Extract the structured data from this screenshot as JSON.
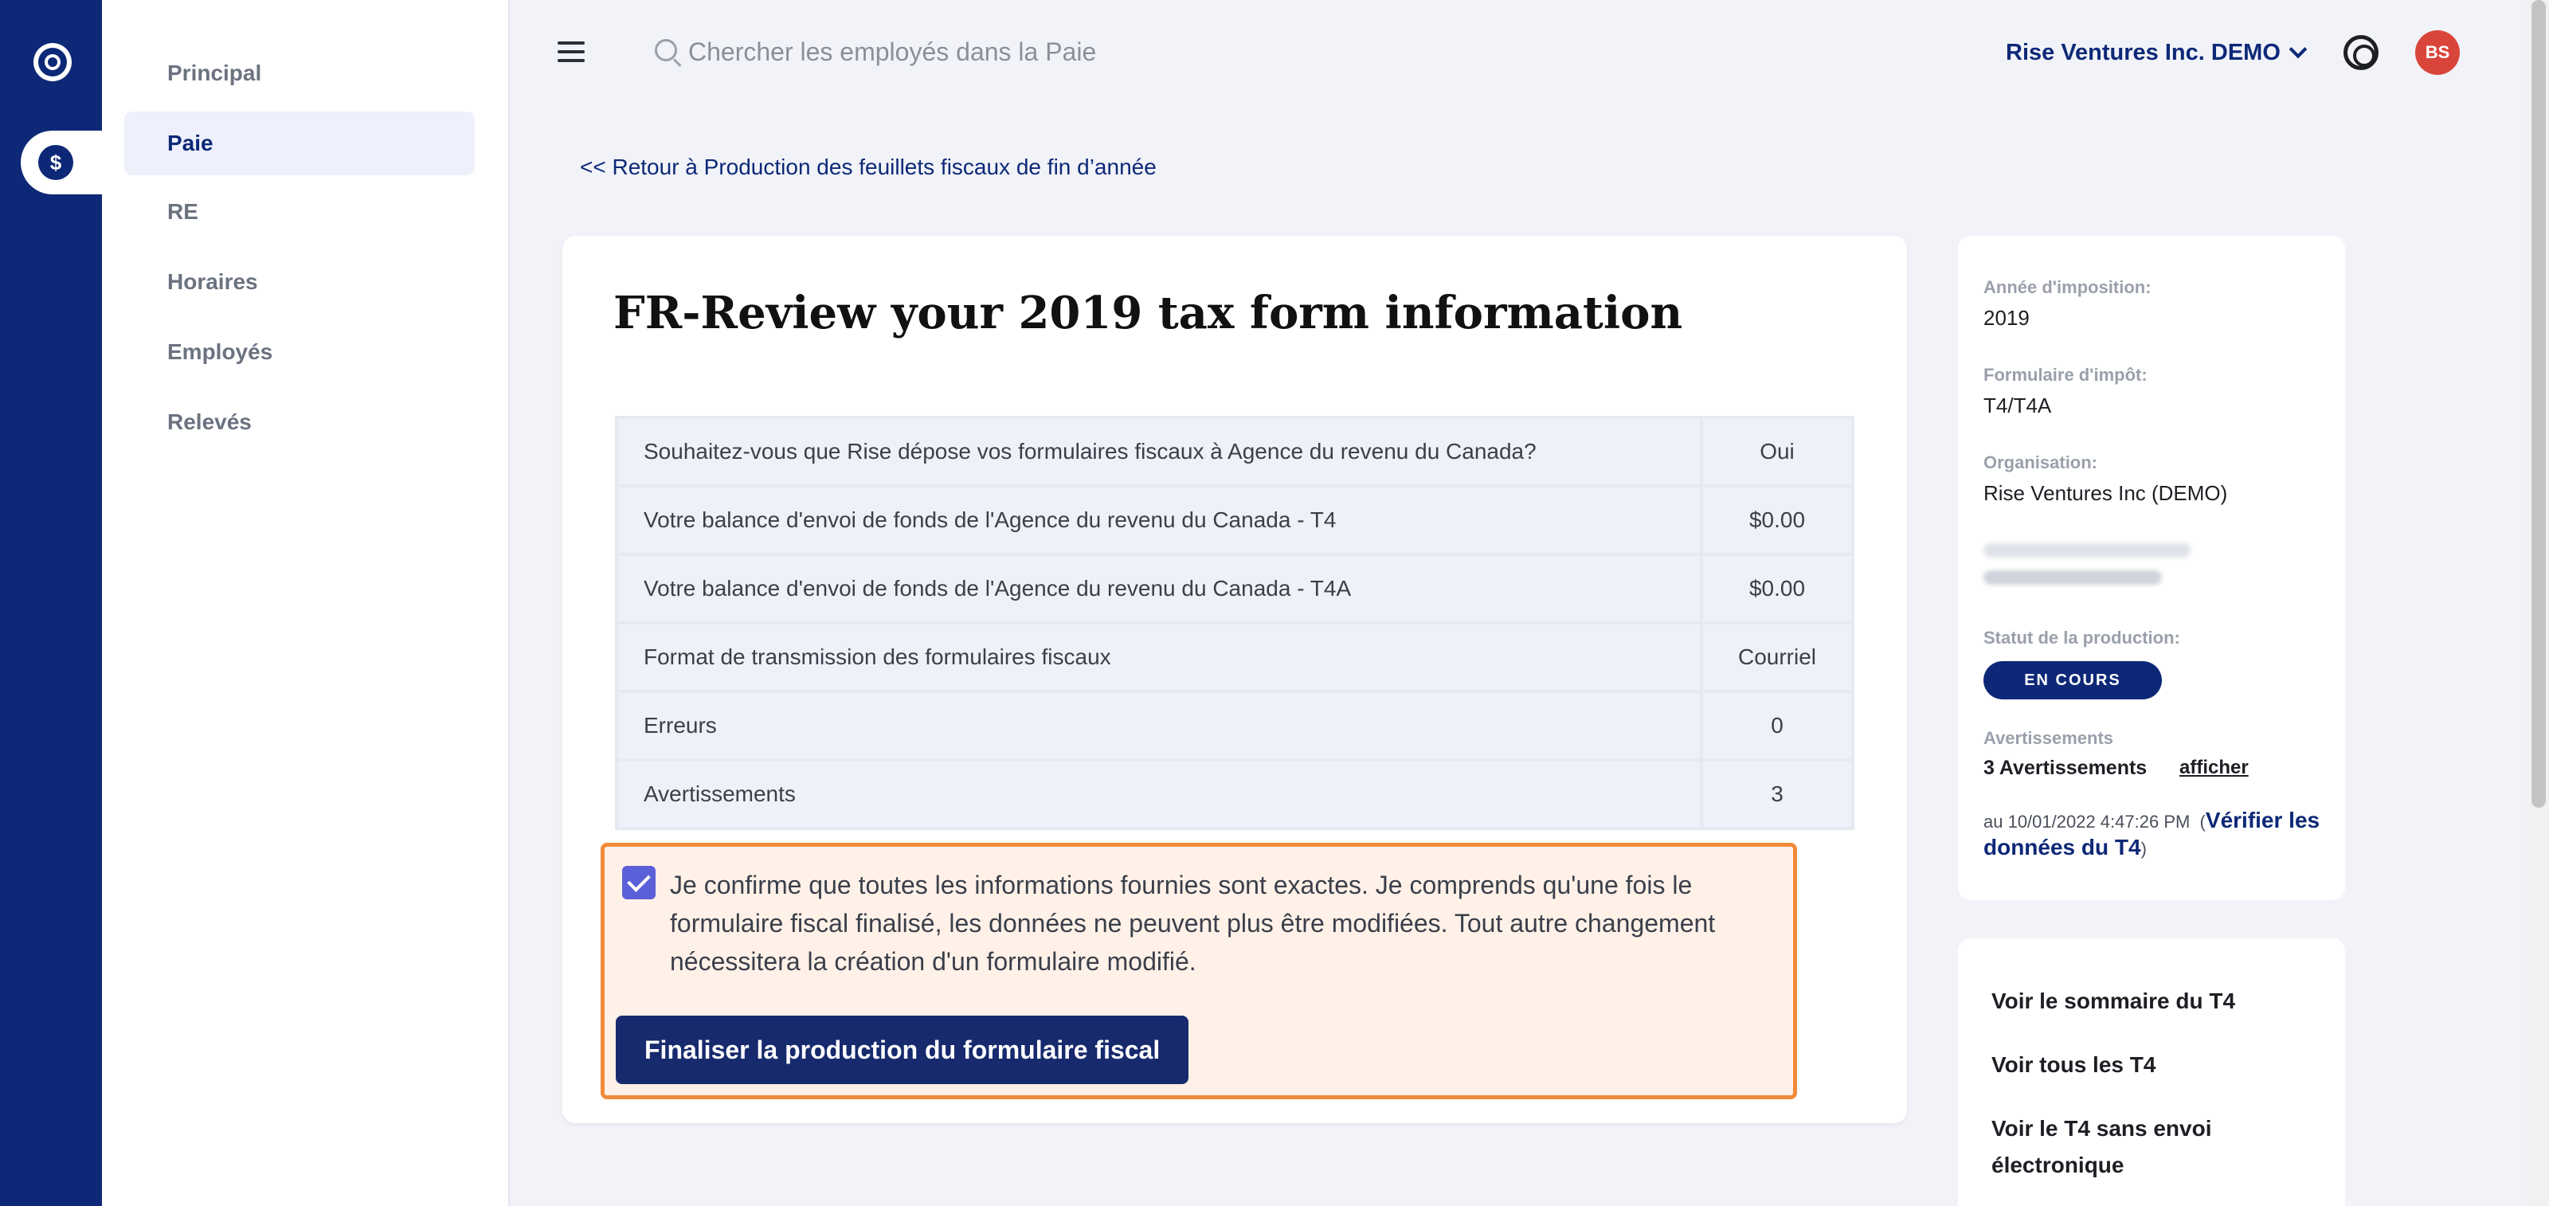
{
  "topbar": {
    "search_placeholder": "Chercher les employés dans la Paie",
    "company_name": "Rise Ventures Inc. DEMO",
    "avatar_initials": "BS"
  },
  "subnav": {
    "items": [
      {
        "label": "Principal",
        "active": false
      },
      {
        "label": "Paie",
        "active": true
      },
      {
        "label": "RE",
        "active": false
      },
      {
        "label": "Horaires",
        "active": false
      },
      {
        "label": "Employés",
        "active": false
      },
      {
        "label": "Relevés",
        "active": false
      }
    ]
  },
  "back_link": "<< Retour à Production des feuillets fiscaux de fin d’année",
  "main": {
    "title": "FR-Review your 2019 tax form information",
    "rows": [
      {
        "label": "Souhaitez-vous que Rise dépose vos formulaires fiscaux à Agence du revenu du Canada?",
        "value": "Oui"
      },
      {
        "label": "Votre balance d'envoi de fonds de l'Agence du revenu du Canada - T4",
        "value": "$0.00"
      },
      {
        "label": "Votre balance d'envoi de fonds de l'Agence du revenu du Canada - T4A",
        "value": "$0.00"
      },
      {
        "label": "Format de transmission des formulaires fiscaux",
        "value": "Courriel"
      },
      {
        "label": "Erreurs",
        "value": "0"
      },
      {
        "label": "Avertissements",
        "value": "3"
      }
    ],
    "confirm_text": "Je confirme que toutes les informations fournies sont exactes. Je comprends qu'une fois le formulaire fiscal finalisé, les données ne peuvent plus être modifiées. Tout autre changement nécessitera la création d'un formulaire modifié.",
    "confirm_checked": true,
    "finalize_button": "Finaliser la production du formulaire fiscal"
  },
  "info": {
    "tax_year_label": "Année d'imposition:",
    "tax_year_value": "2019",
    "form_label": "Formulaire d'impôt:",
    "form_value": "T4/T4A",
    "org_label": "Organisation:",
    "org_value": "Rise Ventures Inc (DEMO)",
    "status_label": "Statut de la production:",
    "status_value": "EN COURS",
    "warnings_label": "Avertissements",
    "warnings_value": "3 Avertissements",
    "warnings_link": "afficher",
    "timestamp": "au 10/01/2022 4:47:26 PM",
    "verify_link": "Vérifier les données du T4"
  },
  "side_links": [
    "Voir le sommaire du T4",
    "Voir tous les T4",
    "Voir le T4 sans envoi électronique"
  ],
  "colors": {
    "brand": "#0d2877",
    "accent_orange": "#f18b3a",
    "avatar": "#d9453a"
  }
}
